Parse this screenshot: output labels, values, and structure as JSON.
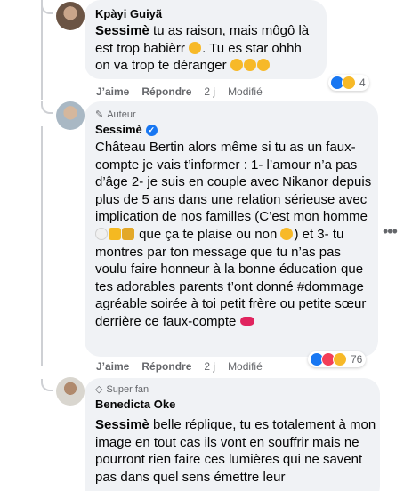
{
  "comments": [
    {
      "author": "Kpàyi Guiyã",
      "mention": "Sessimè",
      "text": " tu as raison, mais môgô là est trop babièrr",
      "text2": ". Tu es star ohhh on va trop te déranger ",
      "actions": {
        "like": "J’aime",
        "reply": "Répondre",
        "time": "2 j",
        "modified": "Modifié"
      },
      "reaction_count": "4",
      "reactions": [
        "like",
        "haha"
      ]
    },
    {
      "badge": "Auteur",
      "author": "Sessimè",
      "text_a": "Château Bertin alors même si tu as un faux-compte je vais t’informer : 1- l’amour n’a pas d’âge 2- je suis en couple avec Nikanor depuis plus de 5 ans dans une relation sérieuse avec implication de nos familles (C’est mon homme ",
      "text_b": " que ça te plaise ou non ",
      "text_c": ") et 3- tu montres par ton message que tu n’as pas voulu faire honneur à la bonne éducation que tes adorables parents t’ont donné #dommage agréable soirée à toi petit frère ou petite sœur derrière ce faux-compte ",
      "actions": {
        "like": "J’aime",
        "reply": "Répondre",
        "time": "2 j",
        "modified": "Modifié"
      },
      "reaction_count": "76",
      "reactions": [
        "like",
        "love",
        "care"
      ]
    },
    {
      "badge": "Super fan",
      "author": "Benedicta Oke",
      "mention": "Sessimè",
      "text": " belle réplique, tu es totalement à mon image en tout cas ils vont en souffrir mais ne pourront rien faire ces lumières qui ne savent pas dans quel sens émettre leur"
    }
  ],
  "more_icon": "more-horizontal-icon"
}
